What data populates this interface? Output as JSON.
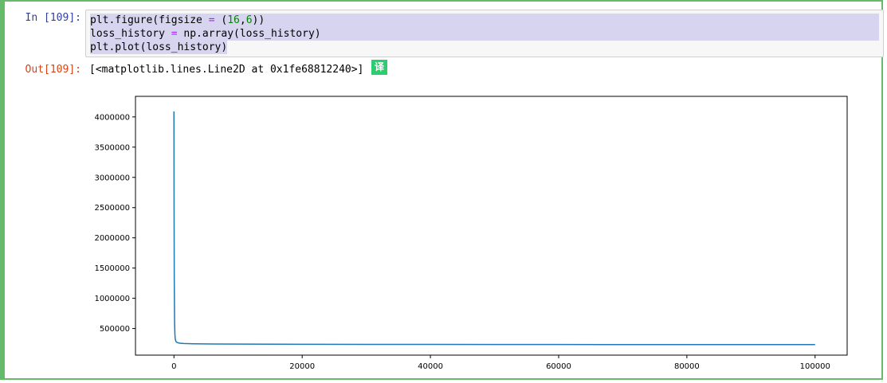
{
  "cell": {
    "in_prompt": "In  [109]:",
    "out_prompt": "Out[109]:",
    "code": {
      "line1": {
        "pre": "plt.figure(figsize ",
        "op": "=",
        "mid": " (",
        "num1": "16",
        "comma": ",",
        "num2": "6",
        "post": "))"
      },
      "line2": {
        "pre": "loss_history ",
        "op": "=",
        "post": " np.array(loss_history)"
      },
      "line3": "plt.plot(loss_history)"
    },
    "output_text": "[<matplotlib.lines.Line2D at 0x1fe68812240>]",
    "translate_badge": "译"
  },
  "chart_data": {
    "type": "line",
    "title": "",
    "xlabel": "",
    "ylabel": "",
    "xlim": [
      -6000,
      105000
    ],
    "ylim": [
      60000,
      4340000
    ],
    "xticks": [
      0,
      20000,
      40000,
      60000,
      80000,
      100000
    ],
    "xtick_labels": [
      "0",
      "20000",
      "40000",
      "60000",
      "80000",
      "100000"
    ],
    "yticks": [
      500000,
      1000000,
      1500000,
      2000000,
      2500000,
      3000000,
      3500000,
      4000000
    ],
    "ytick_labels": [
      "500000",
      "1000000",
      "1500000",
      "2000000",
      "2500000",
      "3000000",
      "3500000",
      "4000000"
    ],
    "line_color": "#1f77b4",
    "series": [
      {
        "x": [
          0,
          20,
          50,
          100,
          150,
          200,
          300,
          400,
          600,
          900,
          1500,
          3000,
          6000,
          10000,
          20000,
          30000,
          40000,
          50000,
          60000,
          70000,
          80000,
          90000,
          100000
        ],
        "y": [
          4090000,
          2500000,
          1300000,
          600000,
          400000,
          330000,
          290000,
          275000,
          265000,
          258000,
          252000,
          248000,
          245000,
          243000,
          240000,
          238000,
          237000,
          236000,
          236000,
          235000,
          235000,
          235000,
          234000
        ]
      }
    ]
  }
}
